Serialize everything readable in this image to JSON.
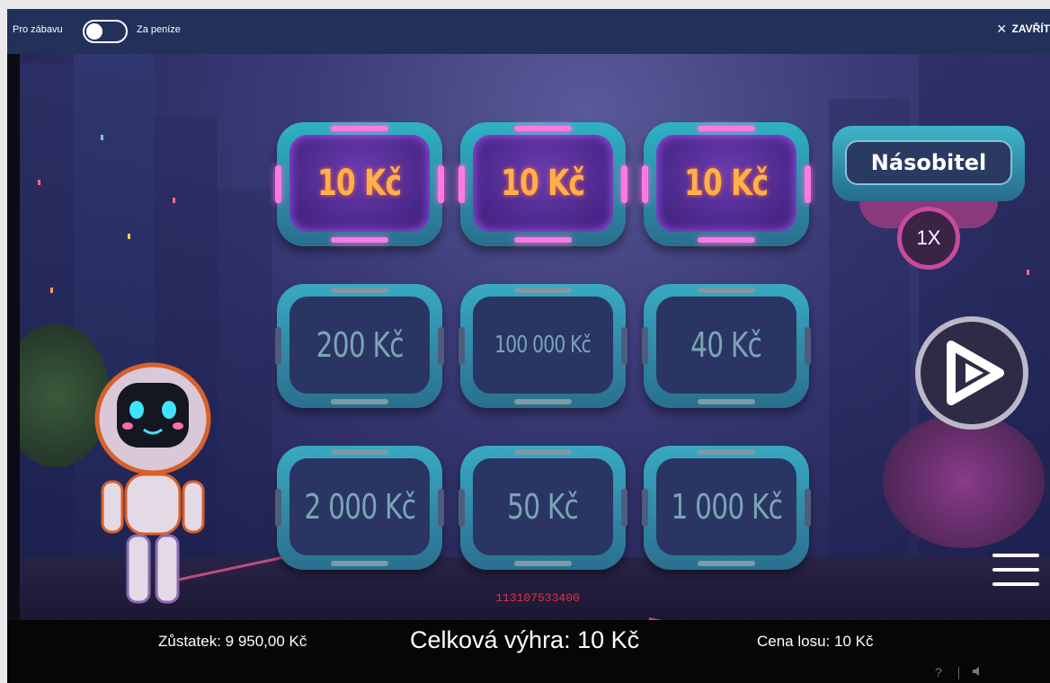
{
  "topbar": {
    "mode_fun": "Pro zábavu",
    "mode_money": "Za peníze",
    "close_label": "ZAVŘÍT",
    "close_icon": "×"
  },
  "tiles": [
    {
      "value": "10 Kč",
      "revealed": true
    },
    {
      "value": "10 Kč",
      "revealed": true
    },
    {
      "value": "10 Kč",
      "revealed": true
    },
    {
      "value": "200 Kč",
      "revealed": false
    },
    {
      "value": "100 000 Kč",
      "revealed": false
    },
    {
      "value": "40 Kč",
      "revealed": false
    },
    {
      "value": "2 000 Kč",
      "revealed": false
    },
    {
      "value": "50 Kč",
      "revealed": false
    },
    {
      "value": "1 000 Kč",
      "revealed": false
    }
  ],
  "multiplier": {
    "label": "Násobitel",
    "value": "1X"
  },
  "ticket_id": "113107533400",
  "bottombar": {
    "balance": "Zůstatek: 9 950,00 Kč",
    "total_win": "Celková výhra: 10 Kč",
    "price": "Cena losu: 10 Kč",
    "help": "?"
  },
  "colors": {
    "topbar_bg": "#23305a",
    "tile_revealed_text": "#ffb04a",
    "tile_hidden_text": "#7aa5b5",
    "ticket_id": "#e0323a"
  },
  "icons": [
    "toggle-switch",
    "close-icon",
    "play-icon",
    "menu-icon",
    "help-icon",
    "sound-icon"
  ]
}
